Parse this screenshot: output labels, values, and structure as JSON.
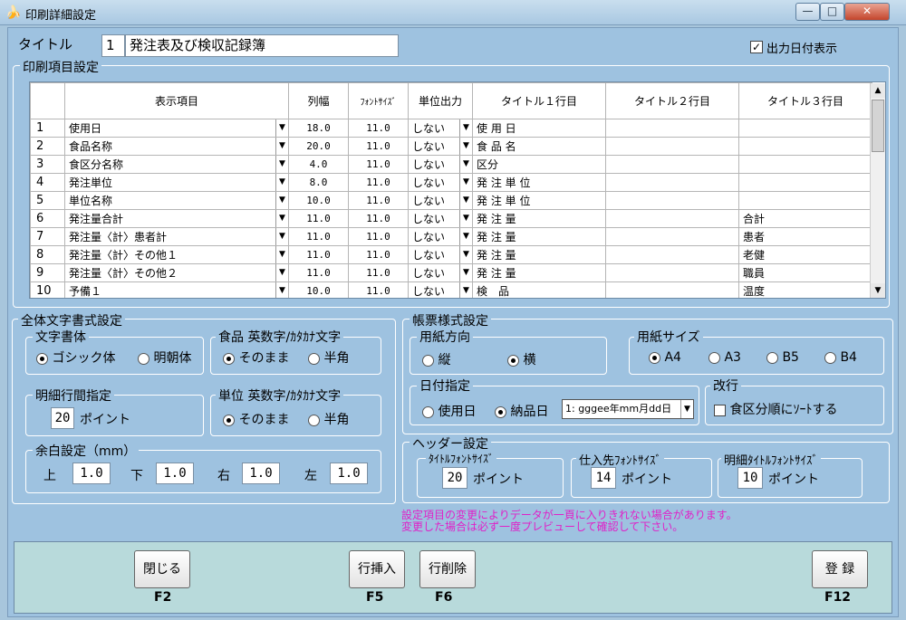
{
  "window": {
    "title": "印刷詳細設定",
    "min": "—",
    "max": "□",
    "close": "✕"
  },
  "title_label": "タイトル",
  "title_no": "1",
  "title_value": "発注表及び検収記録簿",
  "date_print_label": "出力日付表示",
  "grid": {
    "legend": "印刷項目設定",
    "headers": [
      "表示項目",
      "列幅",
      "ﾌｫﾝﾄｻｲｽﾞ",
      "単位出力",
      "タイトル１行目",
      "タイトル２行目",
      "タイトル３行目"
    ],
    "rows": [
      {
        "no": "1",
        "item": "使用日",
        "width": "18.0",
        "font": "11.0",
        "unit": "しない",
        "t1": "使 用 日",
        "t2": "",
        "t3": ""
      },
      {
        "no": "2",
        "item": "食品名称",
        "width": "20.0",
        "font": "11.0",
        "unit": "しない",
        "t1": "食 品 名",
        "t2": "",
        "t3": ""
      },
      {
        "no": "3",
        "item": "食区分名称",
        "width": "4.0",
        "font": "11.0",
        "unit": "しない",
        "t1": "区分",
        "t2": "",
        "t3": ""
      },
      {
        "no": "4",
        "item": "発注単位",
        "width": "8.0",
        "font": "11.0",
        "unit": "しない",
        "t1": "発 注 単 位",
        "t2": "",
        "t3": ""
      },
      {
        "no": "5",
        "item": "単位名称",
        "width": "10.0",
        "font": "11.0",
        "unit": "しない",
        "t1": "発 注 単 位",
        "t2": "",
        "t3": ""
      },
      {
        "no": "6",
        "item": "発注量合計",
        "width": "11.0",
        "font": "11.0",
        "unit": "しない",
        "t1": "発 注 量",
        "t2": "",
        "t3": "合計"
      },
      {
        "no": "7",
        "item": "発注量〈計〉患者計",
        "width": "11.0",
        "font": "11.0",
        "unit": "しない",
        "t1": "発 注 量",
        "t2": "",
        "t3": "患者"
      },
      {
        "no": "8",
        "item": "発注量〈計〉その他１",
        "width": "11.0",
        "font": "11.0",
        "unit": "しない",
        "t1": "発 注 量",
        "t2": "",
        "t3": "老健"
      },
      {
        "no": "9",
        "item": "発注量〈計〉その他２",
        "width": "11.0",
        "font": "11.0",
        "unit": "しない",
        "t1": "発 注 量",
        "t2": "",
        "t3": "職員"
      },
      {
        "no": "10",
        "item": "予備１",
        "width": "10.0",
        "font": "11.0",
        "unit": "しない",
        "t1": "検　品",
        "t2": "",
        "t3": "温度"
      }
    ]
  },
  "font_settings": {
    "legend": "全体文字書式設定",
    "face_legend": "文字書体",
    "gothic": "ゴシック体",
    "mincho": "明朝体",
    "food_legend": "食品 英数字/ｶﾀｶﾅ文字",
    "asis": "そのまま",
    "half": "半角",
    "unit_legend": "単位 英数字/ｶﾀｶﾅ文字",
    "spacing_legend": "明細行間指定",
    "spacing_value": "20",
    "point": "ポイント",
    "margin_legend": "余白設定（mm）",
    "top": "上",
    "top_val": "1.0",
    "bottom": "下",
    "bottom_val": "1.0",
    "right": "右",
    "right_val": "1.0",
    "left": "左",
    "left_val": "1.0"
  },
  "form_settings": {
    "legend": "帳票様式設定",
    "orient_legend": "用紙方向",
    "portrait": "縦",
    "landscape": "横",
    "size_legend": "用紙サイズ",
    "sizes": [
      "A4",
      "A3",
      "B5",
      "B4"
    ],
    "date_legend": "日付指定",
    "use_date": "使用日",
    "delivery_date": "納品日",
    "date_format": "1: gggee年mm月dd日",
    "break_legend": "改行",
    "break_label": "食区分順にｿｰﾄする"
  },
  "header_settings": {
    "legend": "ヘッダー設定",
    "title_font": "ﾀｲﾄﾙﾌｫﾝﾄｻｲｽﾞ",
    "title_font_val": "20",
    "supplier_font": "仕入先ﾌｫﾝﾄｻｲｽﾞ",
    "supplier_font_val": "14",
    "detail_font": "明細ﾀｲﾄﾙﾌｫﾝﾄｻｲｽﾞ",
    "detail_font_val": "10",
    "point": "ポイント"
  },
  "warning": [
    "設定項目の変更によりデータが一頁に入りきれない場合があります。",
    "変更した場合は必ず一度プレビューして確認して下さい。"
  ],
  "buttons": {
    "close": "閉じる",
    "close_key": "F2",
    "insert": "行挿入",
    "insert_key": "F5",
    "delete": "行削除",
    "delete_key": "F6",
    "register": "登 録",
    "register_key": "F12"
  }
}
